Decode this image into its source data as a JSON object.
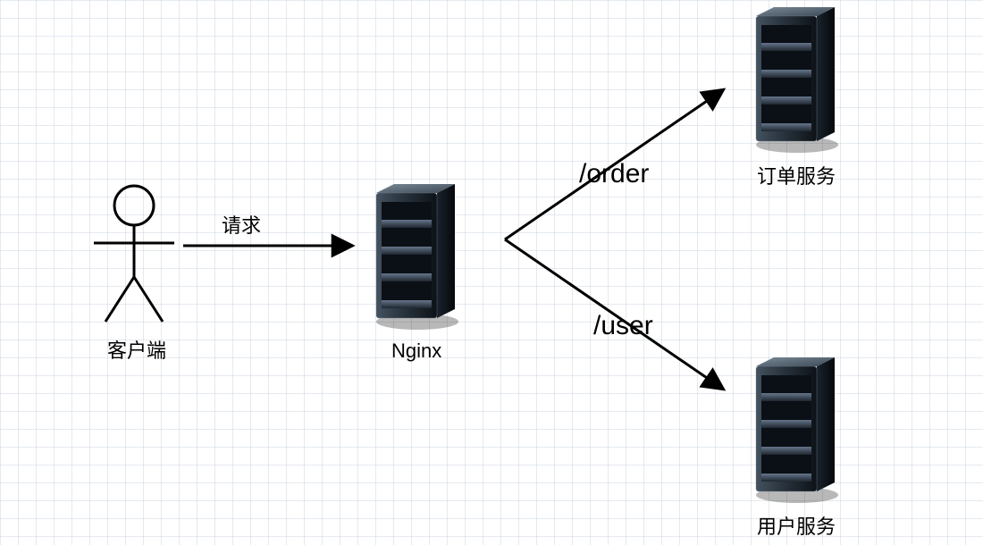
{
  "diagram": {
    "nodes": {
      "client": {
        "label": "客户端"
      },
      "nginx": {
        "label": "Nginx"
      },
      "orderService": {
        "label": "订单服务"
      },
      "userService": {
        "label": "用户服务"
      }
    },
    "edges": {
      "request": {
        "label": "请求"
      },
      "order": {
        "label": "/order"
      },
      "user": {
        "label": "/user"
      }
    }
  }
}
